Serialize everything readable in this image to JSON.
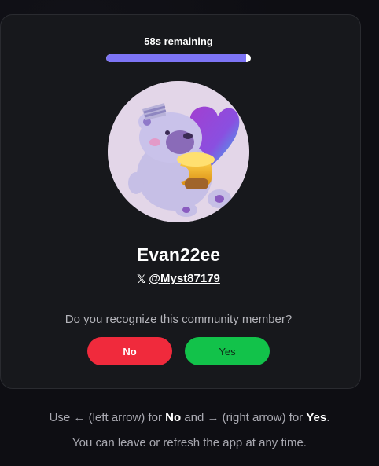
{
  "timer": {
    "label": "58s remaining",
    "progress": 0.97
  },
  "profile": {
    "avatar_icon": "bear-avatar-icon",
    "name": "Evan22ee",
    "x_icon": "𝕏",
    "handle": "@Myst87179"
  },
  "prompt": {
    "question": "Do you recognize this community member?"
  },
  "buttons": {
    "no_label": "No",
    "yes_label": "Yes"
  },
  "hints": {
    "line1_a": "Use ← (left arrow) for ",
    "line1_no": "No",
    "line1_b": " and → (right arrow) for ",
    "line1_yes": "Yes",
    "line1_c": ".",
    "line2": "You can leave or refresh the app at any time."
  },
  "colors": {
    "accent": "#7d74f5",
    "no": "#f02a3c",
    "yes": "#12c24a",
    "card": "#17181c"
  }
}
